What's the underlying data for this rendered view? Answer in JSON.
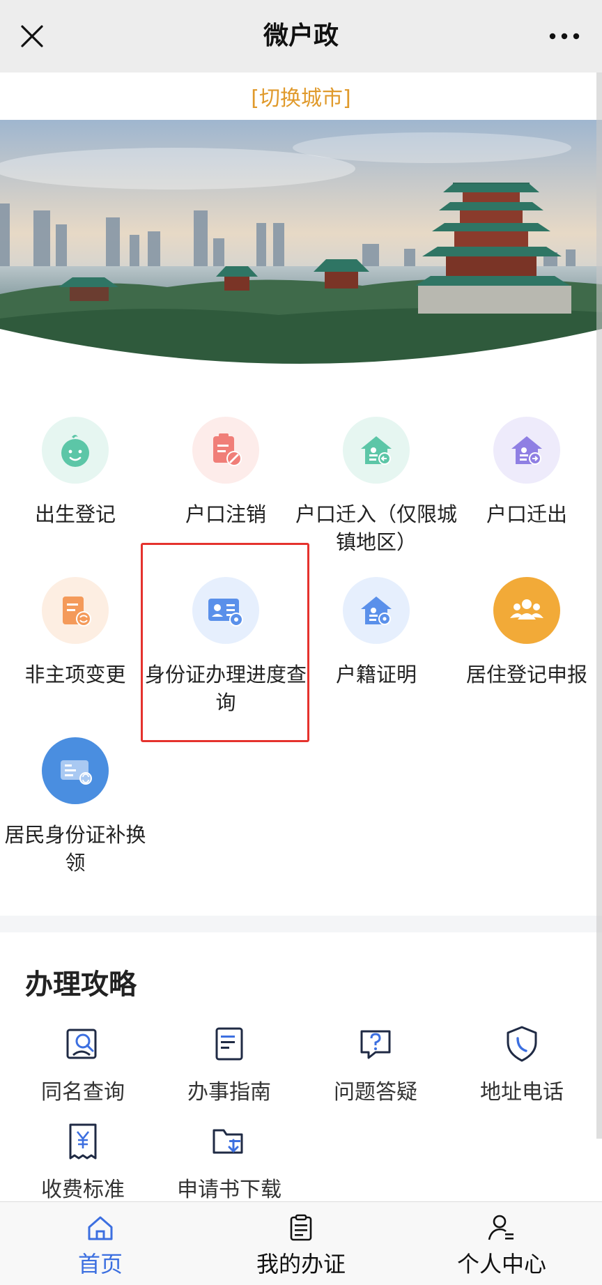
{
  "titlebar": {
    "title": "微户政",
    "close_icon": "close-icon",
    "more_icon": "more-dots-icon"
  },
  "city_switch": {
    "label": "[切换城市]"
  },
  "services": [
    {
      "label": "出生登记",
      "icon": "baby-icon",
      "color": "#e6f6f1"
    },
    {
      "label": "户口注销",
      "icon": "clipboard-cancel-icon",
      "color": "#fdecea"
    },
    {
      "label": "户口迁入（仅限城镇地区）",
      "icon": "house-in-icon",
      "color": "#e6f6f1"
    },
    {
      "label": "户口迁出",
      "icon": "house-out-icon",
      "color": "#eeebfb"
    },
    {
      "label": "非主项变更",
      "icon": "doc-change-icon",
      "color": "#fdeee2"
    },
    {
      "label": "身份证办理进度查询",
      "icon": "id-card-progress-icon",
      "color": "#e6effd"
    },
    {
      "label": "户籍证明",
      "icon": "house-cert-icon",
      "color": "#e6effd"
    },
    {
      "label": "居住登记申报",
      "icon": "people-group-icon",
      "color": "#f2aa38"
    },
    {
      "label": "居民身份证补换领",
      "icon": "id-card-renew-icon",
      "color": "#4a8ee0"
    }
  ],
  "guide": {
    "title": "办理攻略",
    "items": [
      {
        "label": "同名查询",
        "icon": "name-search-icon"
      },
      {
        "label": "办事指南",
        "icon": "guide-doc-icon"
      },
      {
        "label": "问题答疑",
        "icon": "question-icon"
      },
      {
        "label": "地址电话",
        "icon": "shield-phone-icon"
      },
      {
        "label": "收费标准",
        "icon": "fee-receipt-icon"
      },
      {
        "label": "申请书下载",
        "icon": "folder-download-icon"
      }
    ]
  },
  "tabbar": {
    "tabs": [
      {
        "label": "首页",
        "icon": "home-icon",
        "active": true
      },
      {
        "label": "我的办证",
        "icon": "clipboard-icon",
        "active": false
      },
      {
        "label": "个人中心",
        "icon": "user-icon",
        "active": false
      }
    ]
  },
  "colors": {
    "accent": "#3c6fe0",
    "city_switch": "#e09a2c",
    "highlight": "#e5322d"
  }
}
